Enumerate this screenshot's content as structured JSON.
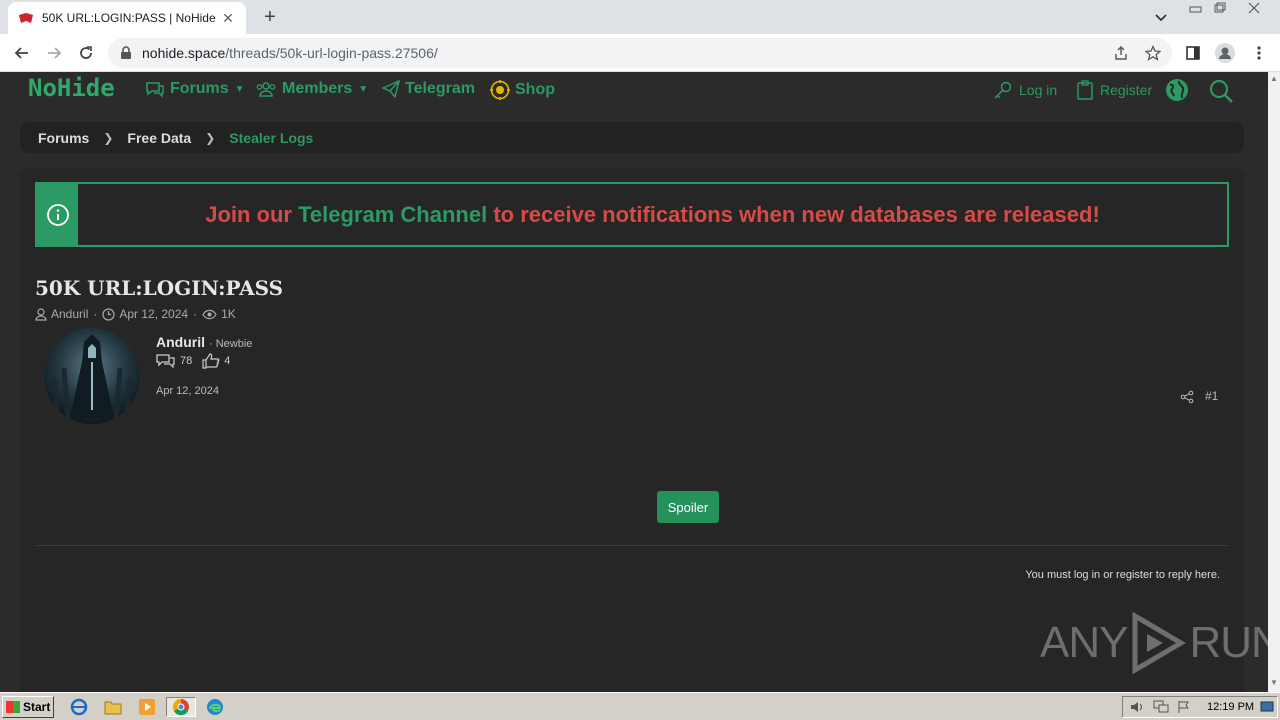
{
  "browser": {
    "tab_title": "50K URL:LOGIN:PASS | NoHide",
    "tab_close": "✕",
    "new_tab": "+",
    "url_host": "nohide.space",
    "url_path": "/threads/50k-url-login-pass.27506/"
  },
  "site": {
    "logo": "NoHide",
    "nav": {
      "forums": "Forums",
      "members": "Members",
      "telegram": "Telegram",
      "shop": "Shop",
      "login": "Log in",
      "register": "Register"
    },
    "breadcrumbs": [
      "Forums",
      "Free Data",
      "Stealer Logs"
    ],
    "notice": {
      "part1": "Join our ",
      "highlight": "Telegram Channel",
      "part2": " to receive notifications when new databases are released!"
    },
    "thread": {
      "title": "50K URL:LOGIN:PASS",
      "author": "Anduril",
      "date": "Apr 12, 2024",
      "views": "1K"
    },
    "post": {
      "username": "Anduril",
      "role": "· Newbie",
      "messages": "78",
      "reactions": "4",
      "date": "Apr 12, 2024",
      "number": "#1",
      "spoiler_label": "Spoiler"
    },
    "reply_note": "You must log in or register to reply here."
  },
  "watermark": {
    "left": "ANY",
    "right": "RUN"
  },
  "taskbar": {
    "start": "Start",
    "clock": "12:19 PM"
  },
  "colors": {
    "accent": "#2b9a64",
    "notice_red": "#d84a45",
    "bg": "#2b2b2b"
  }
}
